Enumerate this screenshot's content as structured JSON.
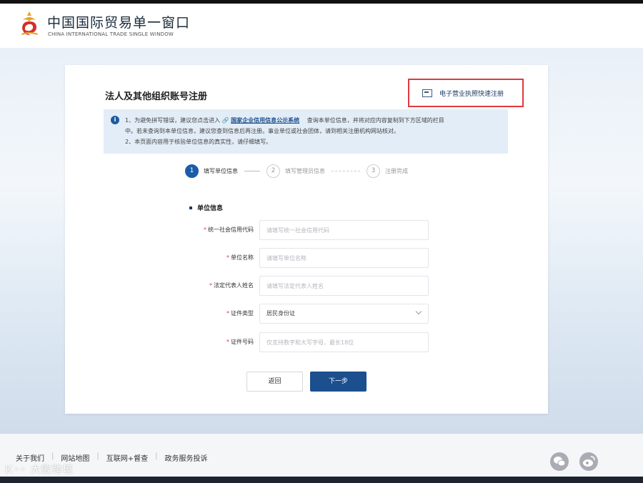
{
  "header": {
    "title": "中国国际贸易单一窗口",
    "subtitle": "CHINA INTERNATIONAL TRADE SINGLE WINDOW"
  },
  "form": {
    "title": "法人及其他组织账号注册",
    "quick_register_label": "电子营业执照快速注册",
    "notice": {
      "line1_prefix": "1、为避免拼写错误，建议您点击进入",
      "line1_link": "国家企业信用信息公示系统",
      "line1_suffix": "查询本单位信息，并将对应内容复制到下方区域的栏目",
      "line2": "中。若未查询到本单位信息，建议您查到信息后再注册。事业单位或社会团体，请到相关注册机构网站核对。",
      "line3": "2、本页面内容用于核验单位信息的真实性，请仔细填写。"
    },
    "steps": [
      {
        "num": "1",
        "label": "填写单位信息"
      },
      {
        "num": "2",
        "label": "填写管理员信息"
      },
      {
        "num": "3",
        "label": "注册完成"
      }
    ],
    "section_title": "单位信息",
    "fields": [
      {
        "label": "统一社会信用代码",
        "placeholder": "请填写统一社会信用代码",
        "value": ""
      },
      {
        "label": "单位名称",
        "placeholder": "请填写单位名称",
        "value": ""
      },
      {
        "label": "法定代表人姓名",
        "placeholder": "请填写法定代表人姓名",
        "value": ""
      },
      {
        "label": "证件类型",
        "placeholder": "",
        "value": "居民身份证"
      },
      {
        "label": "证件号码",
        "placeholder": "仅支持数字和大写字母，最长18位",
        "value": ""
      }
    ],
    "required_mark": "*",
    "back_label": "返回",
    "next_label": "下一步"
  },
  "footer": {
    "links": [
      "关于我们",
      "网站地图",
      "互联网+督查",
      "政务服务投诉"
    ],
    "separator": "|",
    "watermark": "大败跨境"
  },
  "icons": {
    "info": "info-icon",
    "link": "link-icon",
    "license": "business-license-icon",
    "wechat": "wechat-icon",
    "weibo": "weibo-icon",
    "dropdown": "chevron-down-icon"
  },
  "colors": {
    "primary": "#1b4f8e",
    "highlight_border": "#e0393e",
    "notice_bg": "#e3edf7"
  }
}
